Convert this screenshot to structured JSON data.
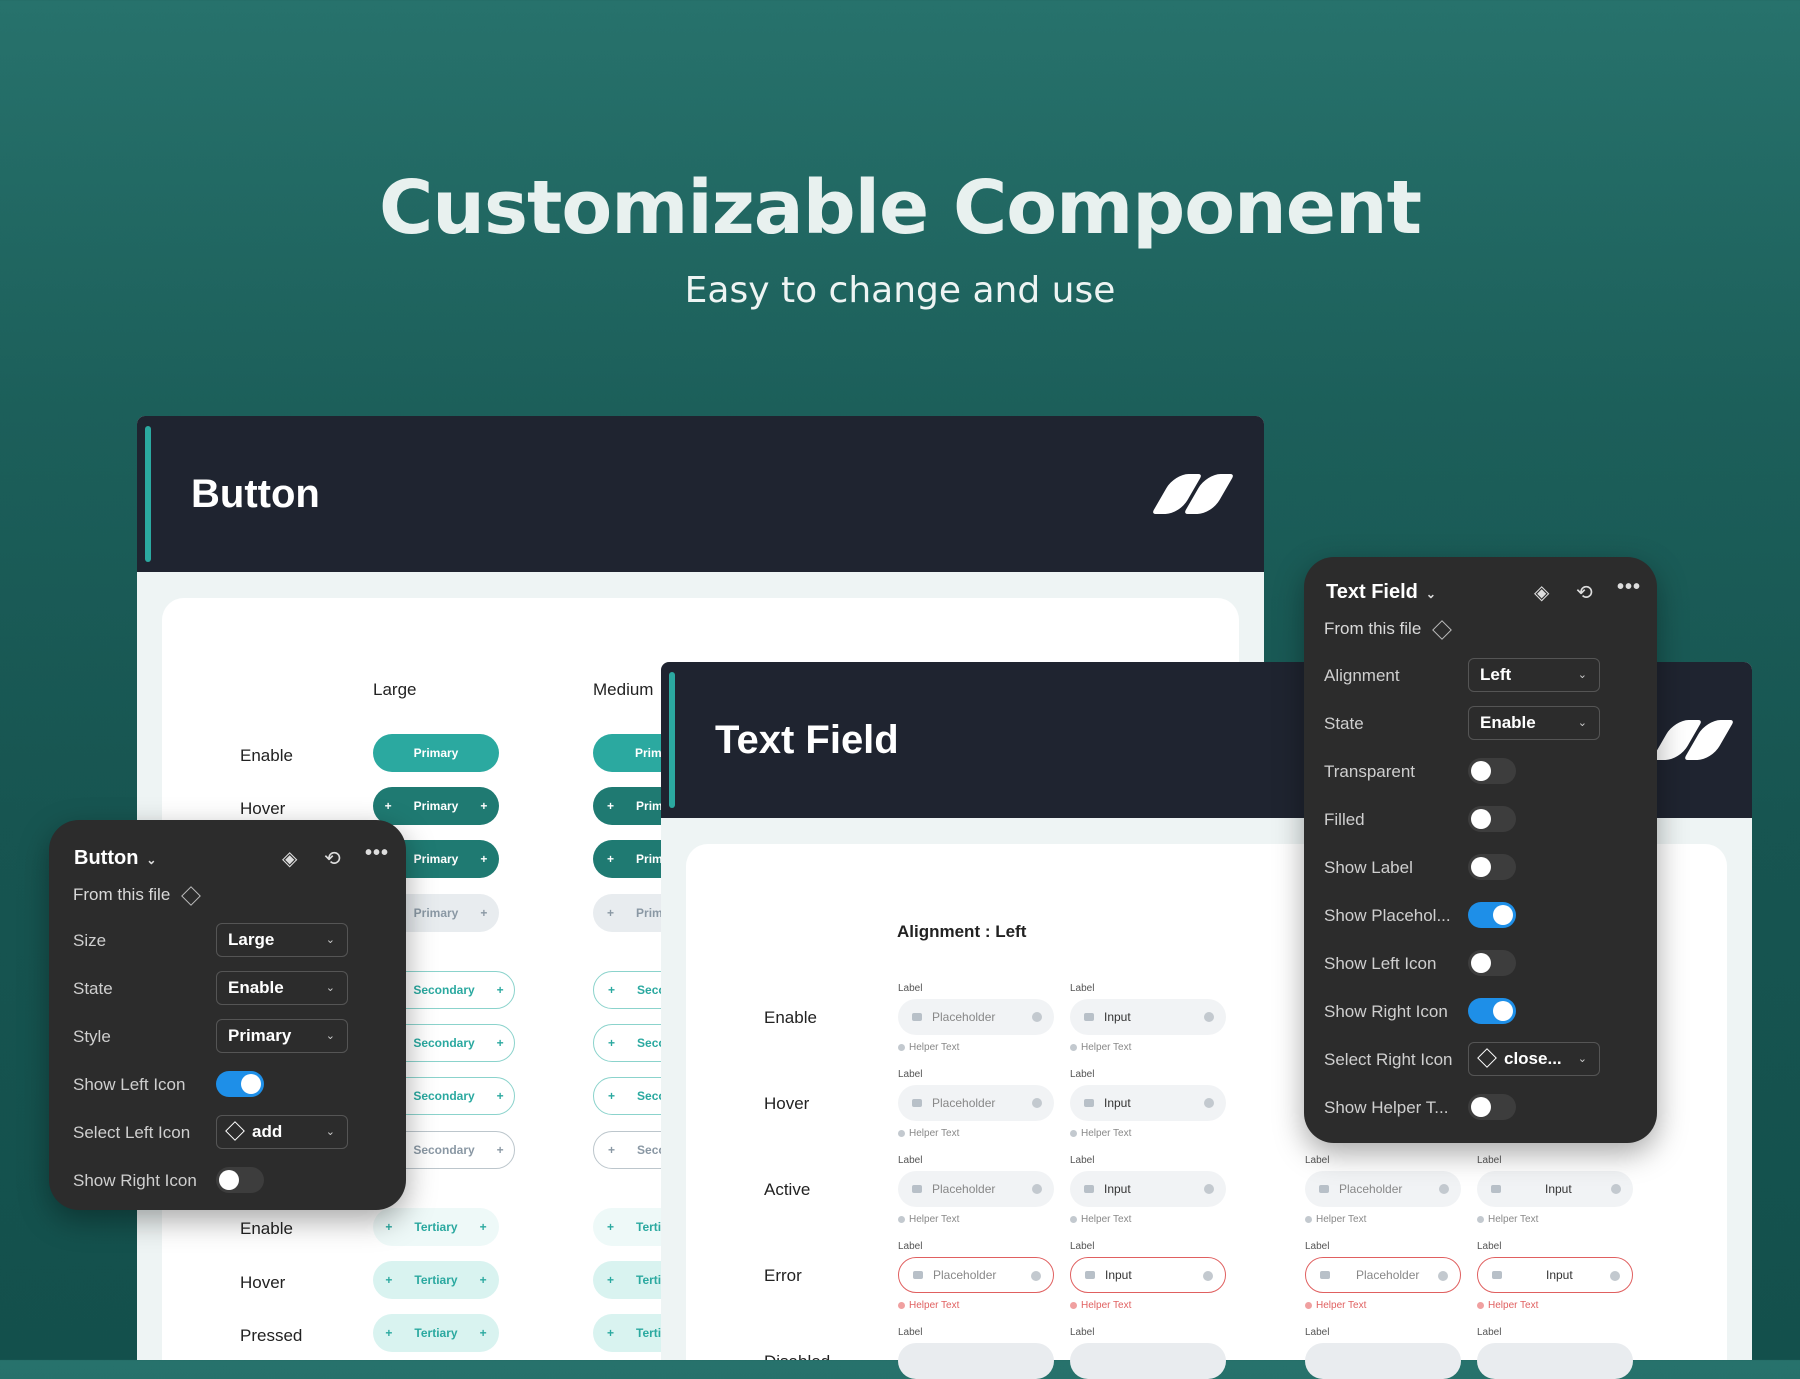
{
  "hero": {
    "title": "Customizable Component",
    "subtitle": "Easy to change and use"
  },
  "button_card": {
    "title": "Button",
    "col_large": "Large",
    "col_medium": "Medium",
    "rows": [
      "Enable",
      "Hover",
      "Enable",
      "Hover",
      "Pressed"
    ],
    "primary": "Primary",
    "secondary": "Secondary",
    "tertiary": "Tertiary",
    "prim_trunc": "Prim",
    "seco_trunc": "Seco",
    "terti_trunc": "Terti"
  },
  "button_panel": {
    "title": "Button",
    "from": "From this file",
    "size_label": "Size",
    "size_value": "Large",
    "state_label": "State",
    "state_value": "Enable",
    "style_label": "Style",
    "style_value": "Primary",
    "left_icon_label": "Show Left Icon",
    "left_icon_on": true,
    "select_left_label": "Select Left Icon",
    "select_left_value": "add",
    "right_icon_label": "Show Right Icon",
    "right_icon_on": false
  },
  "text_card": {
    "title": "Text Field",
    "alignment": "Alignment : Left",
    "rows": [
      "Enable",
      "Hover",
      "Active",
      "Error",
      "Disabled"
    ],
    "label": "Label",
    "placeholder": "Placeholder",
    "input": "Input",
    "helper": "Helper Text"
  },
  "text_panel": {
    "title": "Text Field",
    "from": "From this file",
    "alignment_label": "Alignment",
    "alignment_value": "Left",
    "state_label": "State",
    "state_value": "Enable",
    "transparent_label": "Transparent",
    "filled_label": "Filled",
    "show_label_label": "Show Label",
    "show_placeholder_label": "Show Placehol...",
    "show_left_icon_label": "Show Left Icon",
    "show_right_icon_label": "Show Right Icon",
    "select_right_label": "Select Right Icon",
    "select_right_value": "close...",
    "show_helper_label": "Show Helper T..."
  },
  "colors": {
    "accent": "#2ba9a0",
    "toggle_on": "#1e8fe8",
    "error": "#e06060"
  }
}
